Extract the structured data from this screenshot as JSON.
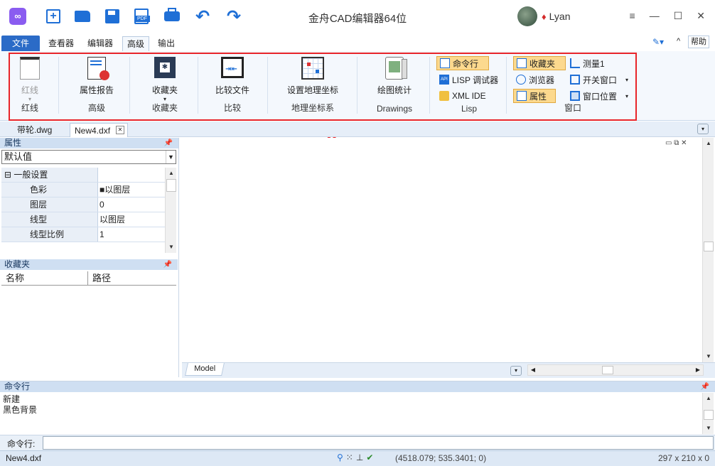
{
  "app": {
    "title": "金舟CAD编辑器64位",
    "user": "Lyan"
  },
  "toolbar": {
    "new_icon": "new-file-icon",
    "open_icon": "folder-open-icon",
    "save_icon": "save-icon",
    "pdf_icon": "pdf-icon",
    "print_icon": "print-icon",
    "undo_icon": "undo-icon",
    "redo_icon": "redo-icon",
    "brand_color": "#1f6fd6"
  },
  "window_controls": {
    "menu": "≡",
    "minimize": "—",
    "maximize": "☐",
    "close": "✕"
  },
  "ribbon_tabs": [
    "文件",
    "查看器",
    "编辑器",
    "高级",
    "输出"
  ],
  "ribbon_right": {
    "help": "帮助",
    "collapse": "^"
  },
  "ribbon": {
    "groups": {
      "redline": {
        "button": "红线",
        "label": "红线"
      },
      "advanced": {
        "button": "属性报告",
        "label": "高级"
      },
      "favorites": {
        "button": "收藏夹",
        "label": "收藏夹"
      },
      "compare": {
        "button": "比较文件",
        "label": "比较"
      },
      "geo": {
        "button": "设置地理坐标",
        "label": "地理坐标系"
      },
      "drawings": {
        "button": "绘图统计",
        "label": "Drawings"
      },
      "lisp": {
        "cmd": "命令行",
        "debugger": "LISP 调试器",
        "ide": "XML IDE",
        "label": "Lisp"
      },
      "window": {
        "favorites": "收藏夹",
        "browser": "浏览器",
        "properties": "属性",
        "measure": "测量1",
        "toggle_window": "开关窗口",
        "window_pos": "窗口位置",
        "label": "窗口"
      }
    }
  },
  "doc_tabs": [
    "带轮.dwg",
    "New4.dxf"
  ],
  "properties_panel": {
    "title": "属性",
    "selected": "默认值",
    "section": "一般设置",
    "rows": [
      {
        "name": "色彩",
        "value": "■以图层"
      },
      {
        "name": "图层",
        "value": "0"
      },
      {
        "name": "线型",
        "value": "以图层"
      },
      {
        "name": "线型比例",
        "value": "1"
      }
    ]
  },
  "favorites_panel": {
    "title": "收藏夹",
    "col_name": "名称",
    "col_path": "路径"
  },
  "canvas": {
    "model_tab": "Model"
  },
  "command_panel": {
    "title": "命令行",
    "lines": [
      "新建",
      "黑色背景"
    ],
    "input_label": "命令行:"
  },
  "status": {
    "file": "New4.dxf",
    "coords": "(4518.079; 535.3401; 0)",
    "paper": "297 x 210 x 0"
  },
  "annotation_color": "#e8252a"
}
